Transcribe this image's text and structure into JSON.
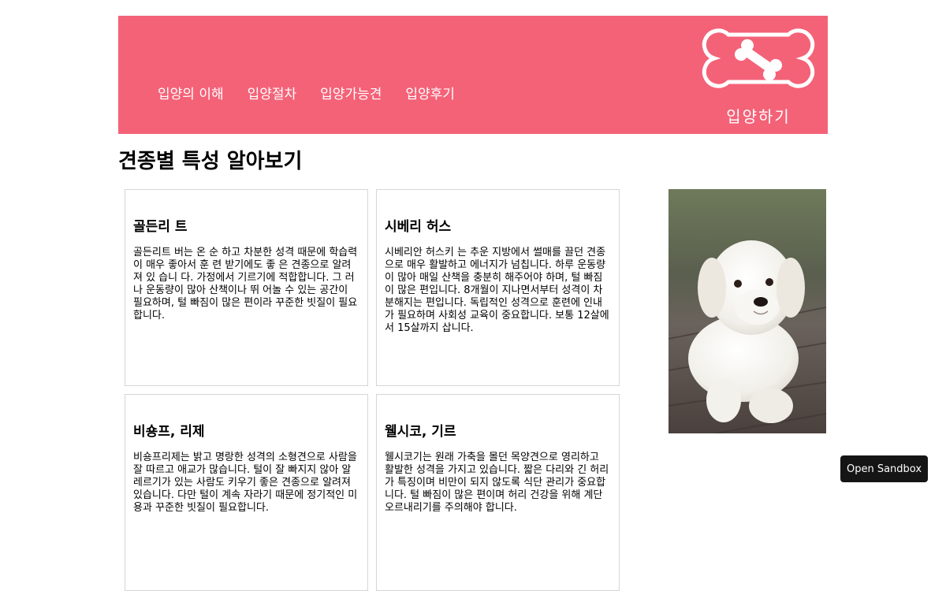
{
  "nav": {
    "items": [
      {
        "label": "입양의 이해"
      },
      {
        "label": "입양절차"
      },
      {
        "label": "입양가능견"
      },
      {
        "label": "입양후기"
      }
    ]
  },
  "logo": {
    "text": "입양하기"
  },
  "page": {
    "title": "견종별 특성 알아보기"
  },
  "cards": [
    {
      "title": "골든리 트",
      "body": "골든리트 버는 온 순 하고 차분한 성격 때문에 학습력이 매우 좋아서 훈 련 받기에도 좋 은 견종으로 알려져 있 습니 다. 가정에서 기르기에 적합합니다. 그 러 나 운동량이 많아 산책이나 뛰 어놀 수 있는 공간이 필요하며, 털 빠짐이 많은 편이라 꾸준한 빗질이 필요합니다."
    },
    {
      "title": "시베리 허스",
      "body": "시베리안 허스키 는 추운 지방에서 썰매를 끌던 견종으로 매우 활발하고 에너지가 넘칩니다. 하루 운동량이 많아 매일 산책을 충분히 해주어야 하며, 털 빠짐이 많은 편입니다. 8개월이 지나면서부터 성격이 차분해지는 편입니다. 독립적인 성격으로 훈련에 인내가 필요하며 사회성 교육이 중요합니다. 보통 12살에서 15살까지 삽니다."
    },
    {
      "title": "비숑프, 리제",
      "body": "비숑프리제는 밝고 명랑한 성격의 소형견으로 사람을 잘 따르고 애교가 많습니다. 털이 잘 빠지지 않아 알레르기가 있는 사람도 키우기 좋은 견종으로 알려져 있습니다. 다만 털이 계속 자라기 때문에 정기적인 미용과 꾸준한 빗질이 필요합니다."
    },
    {
      "title": "웰시코, 기르",
      "body": "웰시코기는 원래 가축을 몰던 목양견으로 영리하고 활발한 성격을 가지고 있습니다. 짧은 다리와 긴 허리가 특징이며 비만이 되지 않도록 식단 관리가 중요합니다. 털 빠짐이 많은 편이며 허리 건강을 위해 계단 오르내리기를 주의해야 합니다."
    }
  ],
  "sandbox": {
    "label": "Open Sandbox"
  },
  "colors": {
    "header": "#f46278",
    "card_border": "#d6d6d6"
  }
}
